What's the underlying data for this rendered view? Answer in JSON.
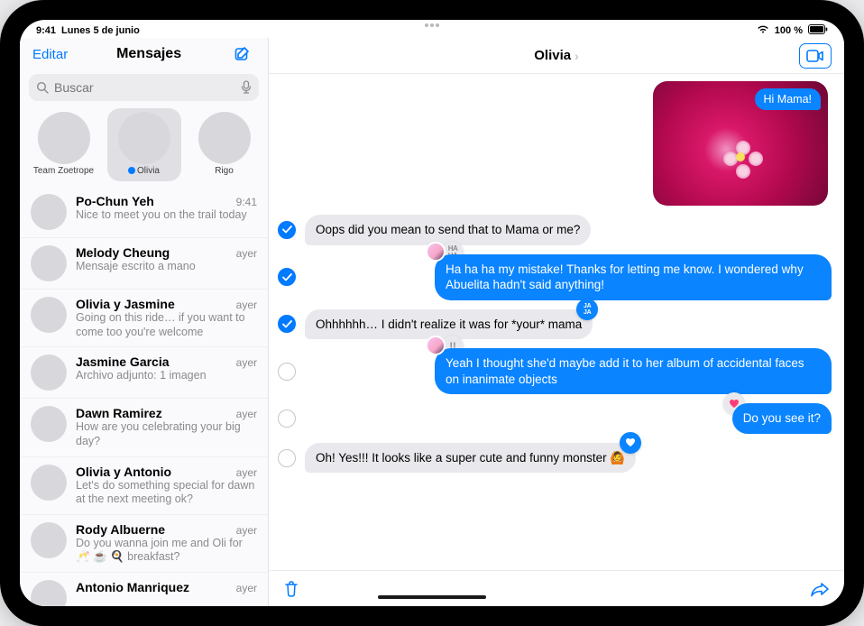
{
  "status": {
    "time": "9:41",
    "date": "Lunes 5 de junio",
    "battery": "100 %"
  },
  "sidebar": {
    "edit": "Editar",
    "title": "Mensajes",
    "search_placeholder": "Buscar",
    "pinned": [
      {
        "name": "Team Zoetrope",
        "selected": false,
        "unread": false
      },
      {
        "name": "Olivia",
        "selected": true,
        "unread": true
      },
      {
        "name": "Rigo",
        "selected": false,
        "unread": false
      }
    ],
    "conversations": [
      {
        "name": "Po-Chun Yeh",
        "time": "9:41",
        "preview": "Nice to meet you on the trail today"
      },
      {
        "name": "Melody Cheung",
        "time": "ayer",
        "preview": "Mensaje escrito a mano"
      },
      {
        "name": "Olivia y Jasmine",
        "time": "ayer",
        "preview": "Going on this ride… if you want to come too you're welcome"
      },
      {
        "name": "Jasmine Garcia",
        "time": "ayer",
        "preview": "Archivo adjunto: 1 imagen"
      },
      {
        "name": "Dawn Ramirez",
        "time": "ayer",
        "preview": "How are you celebrating your big day?"
      },
      {
        "name": "Olivia y Antonio",
        "time": "ayer",
        "preview": "Let's do something special for dawn at the next meeting ok?"
      },
      {
        "name": "Rody Albuerne",
        "time": "ayer",
        "preview": "Do you wanna join me and Oli for 🥂 ☕ 🍳 breakfast?"
      },
      {
        "name": "Antonio Manriquez",
        "time": "ayer",
        "preview": ""
      }
    ]
  },
  "chat": {
    "title": "Olivia",
    "image_caption": "Hi Mama!",
    "messages": [
      {
        "id": 0,
        "kind": "image",
        "from": "sent",
        "caption_key": "chat.image_caption"
      },
      {
        "id": 1,
        "kind": "text",
        "from": "received",
        "text": "Oops did you mean to send that to Mama or me?",
        "selected": true
      },
      {
        "id": 2,
        "kind": "text",
        "from": "sent",
        "text": "Ha ha ha my mistake! Thanks for letting me know. I wondered why Abuelita hadn't said anything!",
        "selected": true,
        "tapback_tl": "haha-gray"
      },
      {
        "id": 3,
        "kind": "text",
        "from": "received",
        "text": "Ohhhhhh… I didn't realize it was for *your* mama",
        "selected": true,
        "tapback_tr": "haha-blue"
      },
      {
        "id": 4,
        "kind": "text",
        "from": "sent",
        "text": "Yeah I thought she'd maybe add it to her album of accidental faces on inanimate objects",
        "selected": false,
        "tapback_tl": "exclaim-gray"
      },
      {
        "id": 5,
        "kind": "text",
        "from": "sent",
        "text": "Do you see it?",
        "selected": false,
        "tapback_tl": "heart-pink"
      },
      {
        "id": 6,
        "kind": "text",
        "from": "received",
        "text": "Oh! Yes!!! It looks like a super cute and funny monster 🙆",
        "selected": false,
        "tapback_tr": "heart-blue"
      }
    ]
  }
}
